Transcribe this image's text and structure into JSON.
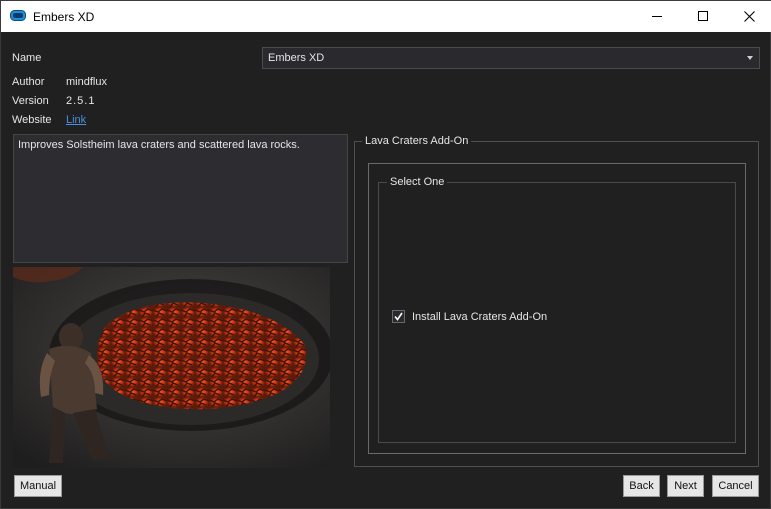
{
  "window": {
    "title": "Embers XD"
  },
  "fields": {
    "name_label": "Name",
    "author_label": "Author",
    "author_value": "mindflux",
    "version_label": "Version",
    "version_value": "2.5.1",
    "website_label": "Website",
    "website_link": "Link"
  },
  "name_dropdown": {
    "selected": "Embers XD"
  },
  "description": "Improves Solstheim lava craters and scattered lava rocks.",
  "options": {
    "group_title": "Lava Craters Add-On",
    "subgroup_title": "Select One",
    "checkbox_label": "Install Lava Craters Add-On",
    "checkbox_checked": true
  },
  "buttons": {
    "manual": "Manual",
    "back": "Back",
    "next": "Next",
    "cancel": "Cancel"
  },
  "icons": {
    "app": "embers-app-icon",
    "minimize": "minimize-icon",
    "maximize": "maximize-icon",
    "close": "close-icon",
    "dropdown": "chevron-down-icon",
    "check": "checkmark-icon"
  },
  "colors": {
    "background": "#202020",
    "link": "#4a90e2",
    "titlebar": "#ffffff",
    "app_icon": "#1e8fd8"
  }
}
